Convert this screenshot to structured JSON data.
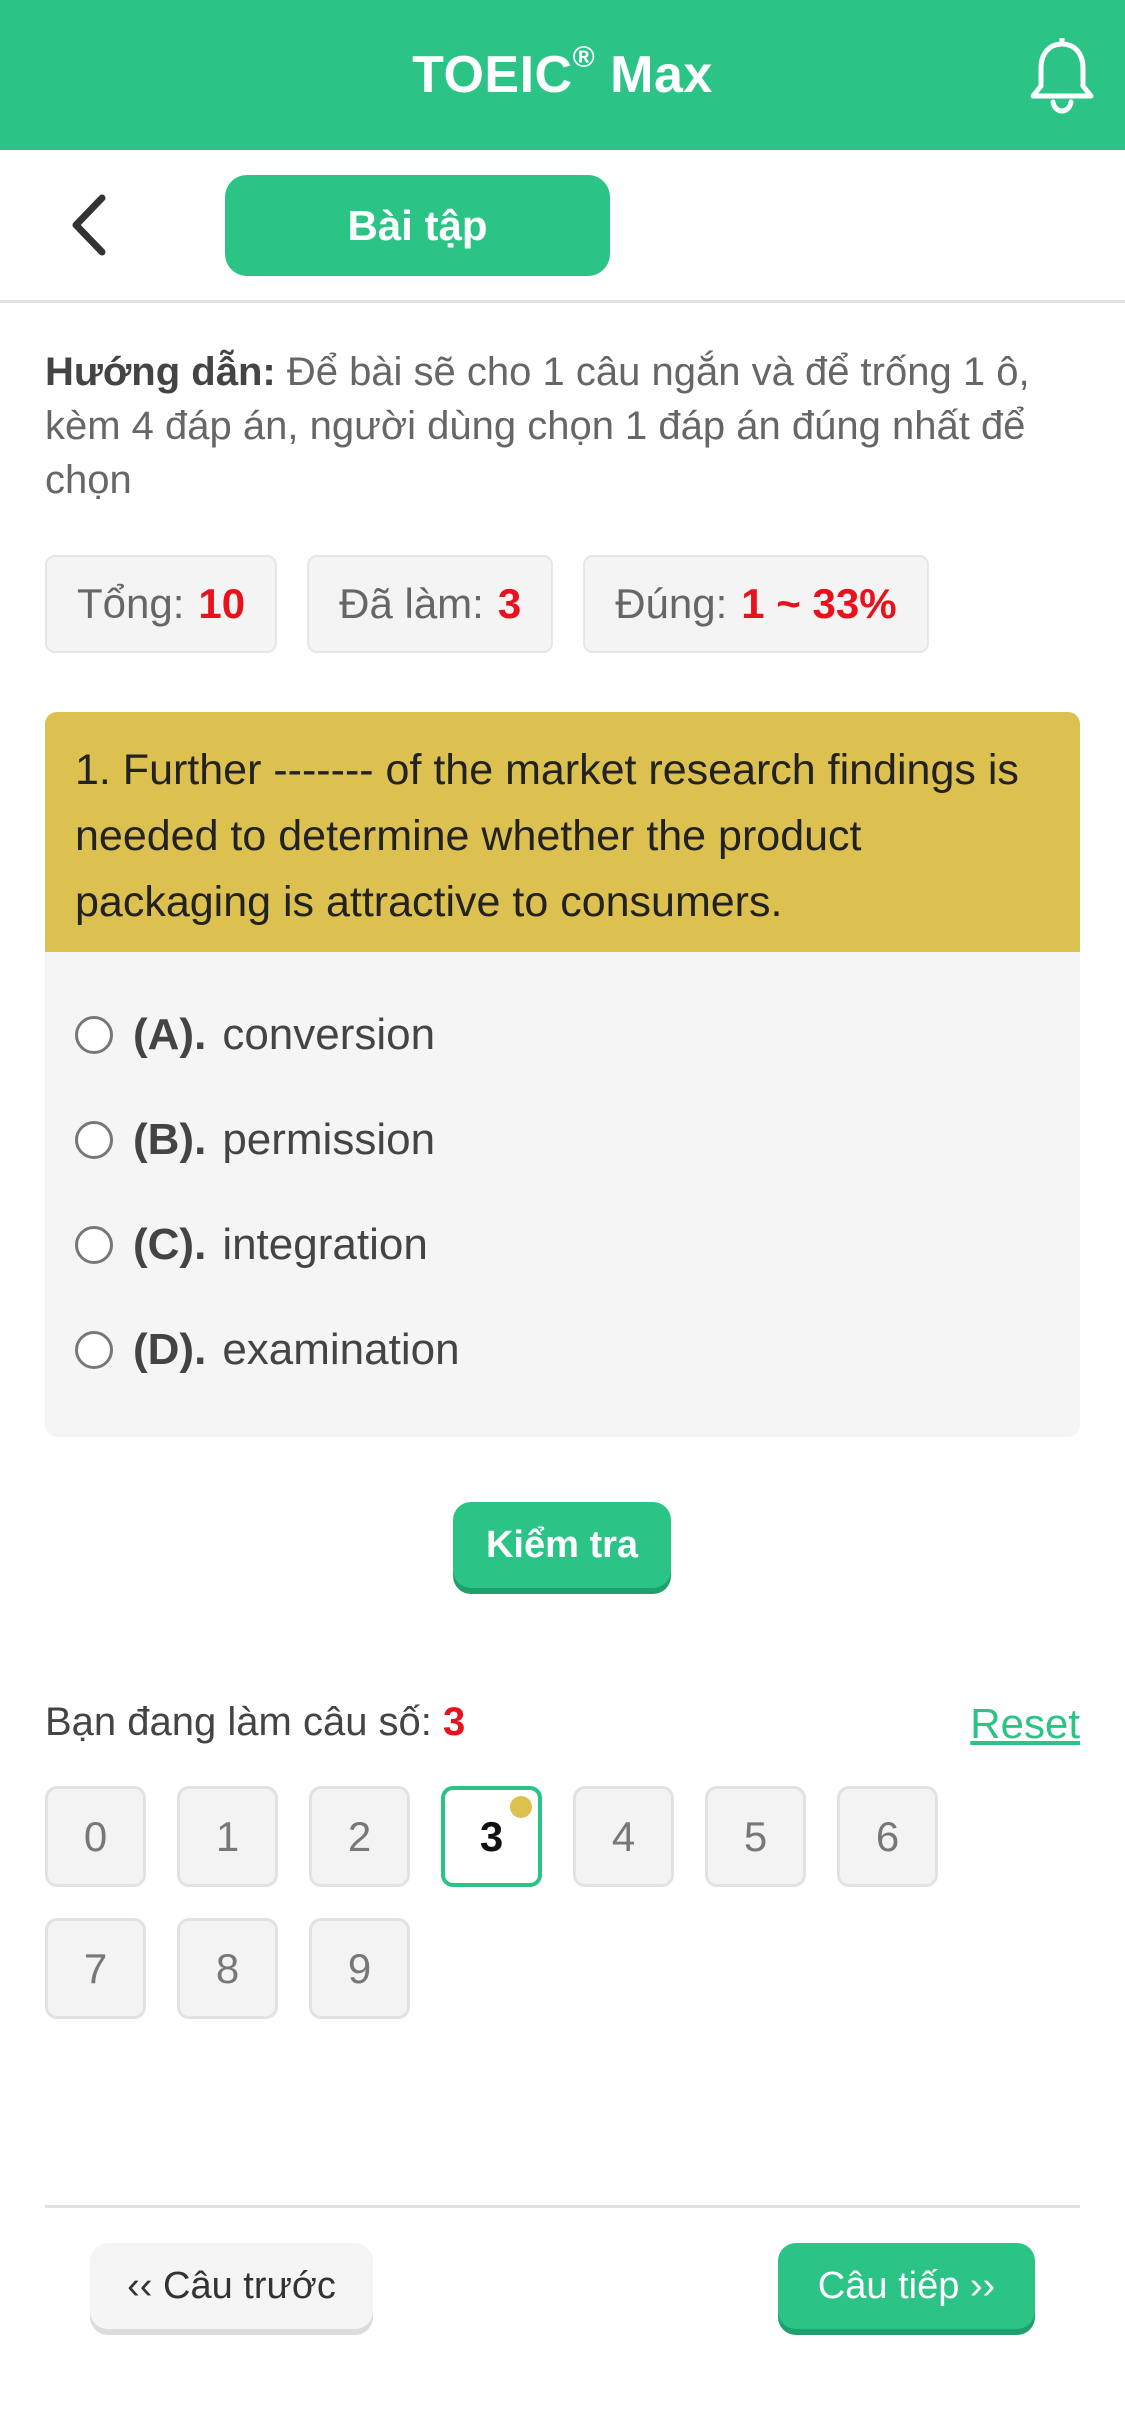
{
  "header": {
    "title": "TOEIC",
    "title_sup": "®",
    "title_suffix": " Max"
  },
  "subheader": {
    "tab_label": "Bài tập"
  },
  "instructions": {
    "label": "Hướng dẫn:",
    "text": " Để bài sẽ cho 1 câu ngắn và để trống 1 ô, kèm 4 đáp án, người dùng chọn 1 đáp án đúng nhất để chọn"
  },
  "stats": {
    "total_label": "Tổng:",
    "total_value": "10",
    "done_label": "Đã làm:",
    "done_value": "3",
    "correct_label": "Đúng:",
    "correct_value": "1 ~ 33%"
  },
  "question": {
    "text": "1. Further ------- of the market research findings is needed to determine whether the product packaging is attractive to consumers.",
    "options": [
      {
        "letter": "(A).",
        "text": "conversion"
      },
      {
        "letter": "(B).",
        "text": "permission"
      },
      {
        "letter": "(C).",
        "text": "integration"
      },
      {
        "letter": "(D).",
        "text": "examination"
      }
    ]
  },
  "check_button": "Kiểm tra",
  "progress": {
    "label": "Bạn đang làm câu số: ",
    "current": "3",
    "reset": "Reset"
  },
  "numbers": [
    "0",
    "1",
    "2",
    "3",
    "4",
    "5",
    "6",
    "7",
    "8",
    "9"
  ],
  "nav": {
    "prev": "‹‹ Câu trước",
    "next": "Câu tiếp ››"
  },
  "colors": {
    "primary": "#2cc486",
    "question_bg": "#dcc050",
    "accent_red": "#e8111c"
  }
}
